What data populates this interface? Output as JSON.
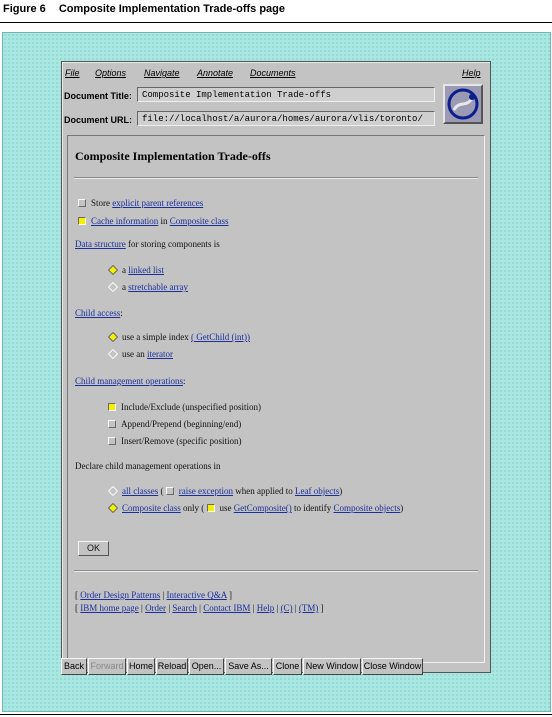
{
  "figure": {
    "number": "Figure 6",
    "caption": "Composite Implementation Trade-offs page"
  },
  "menubar": {
    "file": "File",
    "options": "Options",
    "navigate": "Navigate",
    "annotate": "Annotate",
    "documents": "Documents",
    "help": "Help"
  },
  "document": {
    "title_label": "Document Title:",
    "title_value": "Composite Implementation Trade-offs",
    "url_label": "Document URL:",
    "url_value": "file://localhost/a/aurora/homes/aurora/vlis/toronto/"
  },
  "page": {
    "heading": "Composite Implementation Trade-offs",
    "store": {
      "prefix": "Store ",
      "link": "explicit parent references",
      "checked": false
    },
    "cache": {
      "link1": "Cache information",
      "mid": " in ",
      "link2": "Composite class",
      "checked": true
    },
    "data_structure": {
      "link": "Data structure",
      "suffix": " for storing components is"
    },
    "ds_linked": {
      "prefix": "a ",
      "link": "linked list",
      "selected": true
    },
    "ds_array": {
      "prefix": "a ",
      "link": "stretchable array",
      "selected": false
    },
    "child_access": {
      "link": "Child access",
      "suffix": ":"
    },
    "ca_index": {
      "prefix": "use a simple index ",
      "open": "(",
      "link": " GetChild (int)",
      "close": ")",
      "selected": true
    },
    "ca_iterator": {
      "prefix": "use an ",
      "link": "iterator",
      "selected": false
    },
    "child_mgmt": {
      "link": "Child management operations",
      "suffix": ":"
    },
    "cm_include": {
      "text": "Include/Exclude (unspecified position)",
      "checked": true
    },
    "cm_append": {
      "text": "Append/Prepend (beginning/end)",
      "checked": false
    },
    "cm_insert": {
      "text": "Insert/Remove (specific position)",
      "checked": false
    },
    "declare": {
      "text": "Declare child management operations in"
    },
    "decl_all": {
      "link": "all classes",
      "open": " ( ",
      "link2": "raise exception",
      "mid": " when applied to ",
      "link3": "Leaf objects",
      "close": ")",
      "selected": false,
      "checked": false
    },
    "decl_composite": {
      "link": "Composite class",
      "mid": " only  ( ",
      "pre2": "use ",
      "link2": "GetComposite()",
      "mid2": " to identify ",
      "link3": "Composite objects",
      "close": ")",
      "selected": true,
      "checked": true
    },
    "ok_label": "OK",
    "footer1": {
      "open": "[ ",
      "link1": "Order Design Patterns",
      "sep": " | ",
      "link2": "Interactive Q&A",
      "close": " ]"
    },
    "footer2": {
      "open": "[ ",
      "links": [
        "IBM home page",
        "Order",
        "Search",
        "Contact IBM",
        "Help",
        "(C)",
        "(TM)"
      ],
      "sep": " | ",
      "close": " ]"
    }
  },
  "toolbar": {
    "back": "Back",
    "forward": "Forward",
    "home": "Home",
    "reload": "Reload",
    "open": "Open...",
    "save_as": "Save As...",
    "clone": "Clone",
    "new_window": "New Window",
    "close_window": "Close Window"
  },
  "colors": {
    "desktop": "#a9e8e2",
    "window": "#c3c3c3",
    "link": "#1a2f9c",
    "checked": "#f3f000"
  }
}
